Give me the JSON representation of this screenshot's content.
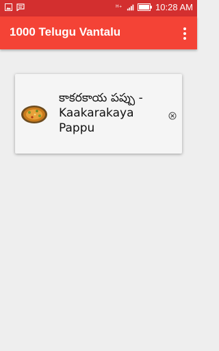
{
  "status_bar": {
    "time": "10:28",
    "am_pm": "AM",
    "icons": [
      "photo-icon",
      "message-icon",
      "wifi-icon",
      "signal-icon",
      "battery-icon"
    ]
  },
  "app_bar": {
    "title": "1000 Telugu Vantalu",
    "menu_icon": "more-vert-icon"
  },
  "list": {
    "items": [
      {
        "title": "కాకరకాయ పప్పు - Kaakarakaya Pappu",
        "thumbnail_icon": "dish-thumbnail",
        "remove_icon": "close-circle-icon"
      }
    ]
  },
  "colors": {
    "status_bar": "#d32f2f",
    "app_bar": "#f44336",
    "background": "#eeeeee",
    "card": "#f5f5f5"
  }
}
